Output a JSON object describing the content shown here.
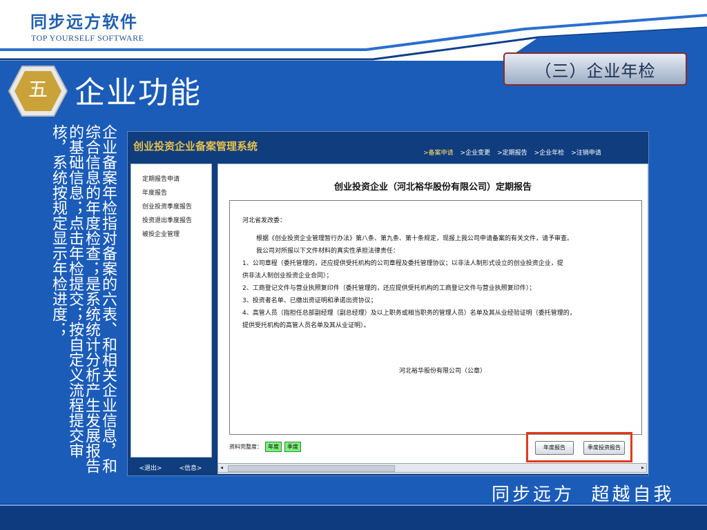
{
  "brand": {
    "title": "同步远方软件",
    "subtitle": "TOP YOURSELF SOFTWARE"
  },
  "section_badge": "（三）企业年检",
  "chapter": {
    "number": "五",
    "title": "企业功能"
  },
  "description": "企业备案年检指对备案的六表、和相关企业信息，和综合信息的年度检查；是系统统计分析产生发展报告的基础信息；点击年检提交；按自定义流程提交审核，系统按规定显示年检进度；",
  "footer_slogan": "同步远方  超越自我",
  "colors": {
    "background": "#1b5cb8",
    "accent_red": "#e23a1a",
    "title_gold": "#e8c14a",
    "chip_green": "#7ef07e"
  },
  "app": {
    "title": "创业投资企业备案管理系统",
    "nav": [
      ">备案申请",
      ">企业变更",
      ">定期报告",
      ">企业年检",
      ">注销申请"
    ],
    "left_menu": [
      "定期报告申请",
      "年度报告",
      "创业投资季度报告",
      "投资退出季度报告",
      "被投企业管理"
    ],
    "left_bottom": {
      "exit": "<退出>",
      "info": "<信息>"
    },
    "doc_title": "创业投资企业（河北裕华股份有限公司）定期报告",
    "doc": {
      "salutation": "河北省发改委：",
      "para1": "根据《创业投资企业管理暂行办法》第八条、第九条、第十条规定，现报上我公司申请备案的有关文件，请予审查。",
      "para2": "我公司对所报以下文件材料的真实性承担法律责任：",
      "item1a": "1、公司章程（委托管理的，还应提供受托机构的公司章程及委托管理协议；以非法人制形式设立的创业投资企业，提",
      "item1b": "供非法人制创业投资企业合同）；",
      "item2": "2、工商登记文件与营业执照复印件（委托管理的，还应提供受托机构的工商登记文件与营业执照复印件）；",
      "item3": "3、投资者名单、已缴出资证明和承诺出资协议；",
      "item4a": "4、高管人员（指担任总部副经理（副总经理）及以上职务或相当职务的管理人员）名单及其从业经验证明（委托管理的，",
      "item4b": "提供受托机构的高管人员名单及其从业证明）。",
      "signature": "河北裕华股份有限公司（公章）"
    },
    "completeness_label": "资料完整度：",
    "chips": [
      "年度",
      "季度"
    ],
    "buttons": [
      "年度报告",
      "季度投资报告"
    ]
  }
}
